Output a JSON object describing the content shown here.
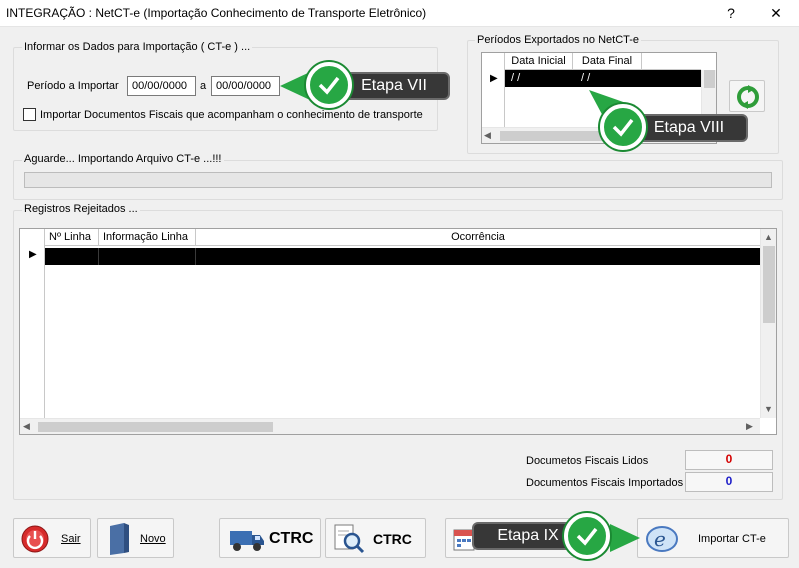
{
  "window": {
    "title": "INTEGRAÇÃO : NetCT-e (Importação Conhecimento de Transporte Eletrônico)",
    "help": "?",
    "close": "✕"
  },
  "import_group": {
    "legend": "Informar os Dados para Importação ( CT-e ) ...",
    "period_label": "Período a Importar",
    "date_from": "00/00/0000",
    "date_sep": "a",
    "date_to": "00/00/0000",
    "fiscal_docs_checked": false,
    "fiscal_docs_label": "Importar Documentos Fiscais que acompanham o conhecimento de transporte"
  },
  "periods_group": {
    "legend": "Períodos Exportados no NetCT-e",
    "columns": [
      "Data Inicial",
      "Data Final"
    ],
    "rows": [
      {
        "data_inicial": "/ /",
        "data_final": "/ /"
      }
    ]
  },
  "progress": {
    "label": "Aguarde... Importando Arquivo CT-e ...!!!",
    "value": 0
  },
  "rejected_group": {
    "legend": "Registros Rejeitados ...",
    "columns": [
      "Nº Linha",
      "Informação Linha",
      "Ocorrência"
    ]
  },
  "stats": {
    "lidos_label": "Documetos Fiscais Lidos",
    "lidos_value": "0",
    "importados_label": "Documentos Fiscais Importados",
    "importados_value": "0",
    "lidos_color": "#d40000",
    "importados_color": "#1c1cc8"
  },
  "buttons": {
    "sair": "Sair",
    "novo": "Novo",
    "ctrc1": "CTRC",
    "ctrc2": "CTRC",
    "importar": "Importar CT-e"
  },
  "annotations": {
    "etapa7": "Etapa VII",
    "etapa8": "Etapa VIII",
    "etapa9": "Etapa IX"
  },
  "icons": {
    "refresh": "refresh-icon",
    "sair": "power-icon",
    "novo": "document-icon",
    "ctrc1": "truck-icon",
    "ctrc2": "search-document-icon",
    "calendar": "calendar-icon",
    "importar": "import-icon"
  }
}
